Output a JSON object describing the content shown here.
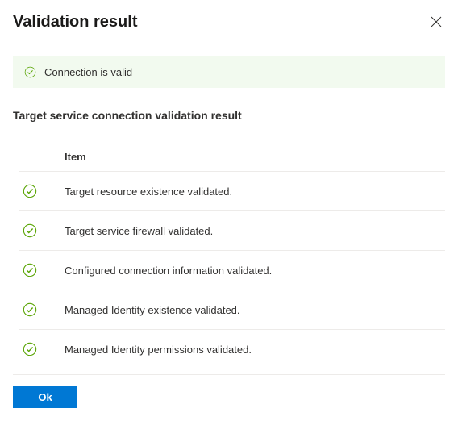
{
  "header": {
    "title": "Validation result"
  },
  "status": {
    "message": "Connection is valid"
  },
  "subtitle": "Target service connection validation result",
  "table": {
    "column_header": "Item",
    "rows": [
      "Target resource existence validated.",
      "Target service firewall validated.",
      "Configured connection information validated.",
      "Managed Identity existence validated.",
      "Managed Identity permissions validated."
    ]
  },
  "footer": {
    "ok_label": "Ok"
  }
}
